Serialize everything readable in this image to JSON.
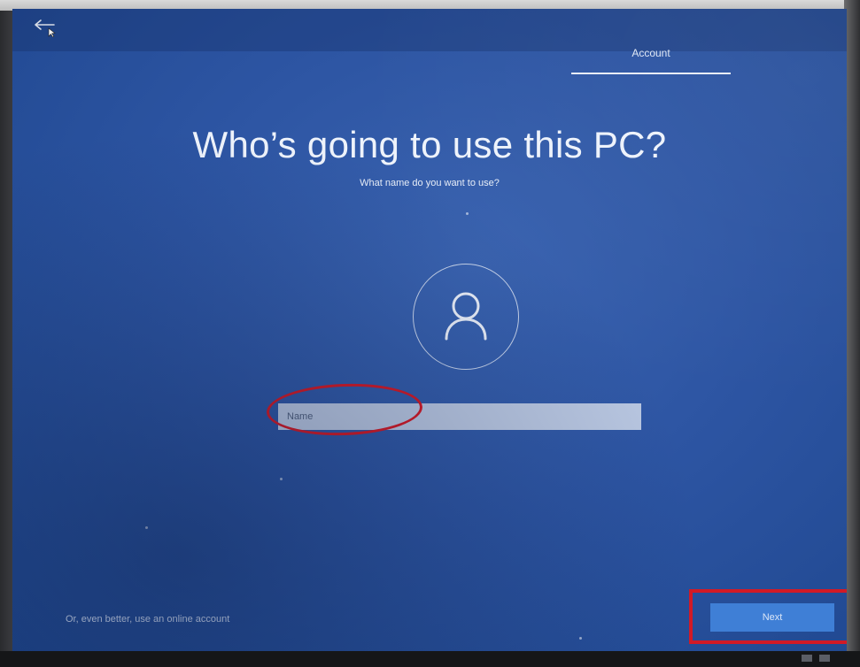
{
  "header": {
    "back_icon": "back-arrow-icon",
    "step_label": "Account"
  },
  "main": {
    "title": "Who’s going to use this PC?",
    "subtitle": "What name do you want to use?",
    "avatar_icon": "user-icon",
    "name_input": {
      "placeholder": "Name",
      "value": ""
    }
  },
  "footer": {
    "online_account_link": "Or, even better, use an online account",
    "next_label": "Next"
  },
  "annotations": {
    "highlight_color": "#d21a26"
  },
  "colors": {
    "background": "#2d55a3",
    "input_bg": "#b9c7e1",
    "next_button_bg": "#3f7fd6"
  }
}
